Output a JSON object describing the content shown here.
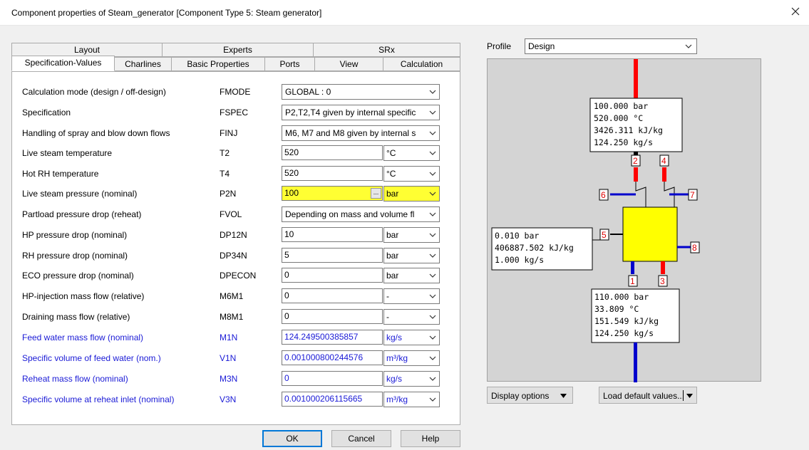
{
  "window": {
    "title": "Component properties of Steam_generator   [Component Type 5: Steam generator]"
  },
  "tabs_back": [
    "Layout",
    "Experts",
    "SRx"
  ],
  "tabs_front": [
    "Specification-Values",
    "Charlines",
    "Basic Properties",
    "Ports",
    "View",
    "Calculation"
  ],
  "rows": [
    {
      "label": "Calculation mode (design / off-design)",
      "code": "FMODE",
      "value": "GLOBAL : 0"
    },
    {
      "label": "Specification",
      "code": "FSPEC",
      "value": "P2,T2,T4 given by internal specific"
    },
    {
      "label": "Handling of spray and blow down flows",
      "code": "FINJ",
      "value": "M6, M7 and M8 given by internal s"
    },
    {
      "label": "Live steam temperature",
      "code": "T2",
      "value": "520",
      "unit": "°C"
    },
    {
      "label": "Hot RH temperature",
      "code": "T4",
      "value": "520",
      "unit": "°C"
    },
    {
      "label": "Live steam pressure (nominal)",
      "code": "P2N",
      "value": "100",
      "unit": "bar"
    },
    {
      "label": "Partload pressure drop (reheat)",
      "code": "FVOL",
      "value": "Depending on mass and volume fl"
    },
    {
      "label": "HP pressure drop (nominal)",
      "code": "DP12N",
      "value": "10",
      "unit": "bar"
    },
    {
      "label": "RH pressure drop (nominal)",
      "code": "DP34N",
      "value": "5",
      "unit": "bar"
    },
    {
      "label": "ECO pressure drop (nominal)",
      "code": "DPECON",
      "value": "0",
      "unit": "bar"
    },
    {
      "label": "HP-injection mass flow (relative)",
      "code": "M6M1",
      "value": "0",
      "unit": "-"
    },
    {
      "label": "Draining mass flow (relative)",
      "code": "M8M1",
      "value": "0",
      "unit": "-"
    },
    {
      "label": "Feed water mass flow (nominal)",
      "code": "M1N",
      "value": "124.249500385857",
      "unit": "kg/s"
    },
    {
      "label": "Specific volume of feed water (nom.)",
      "code": "V1N",
      "value": "0.001000800244576",
      "unit": "m³/kg"
    },
    {
      "label": "Reheat mass flow (nominal)",
      "code": "M3N",
      "value": "0",
      "unit": "kg/s"
    },
    {
      "label": "Specific volume at reheat inlet (nominal)",
      "code": "V3N",
      "value": "0.001000206115665",
      "unit": "m³/kg"
    }
  ],
  "buttons": {
    "ok": "OK",
    "cancel": "Cancel",
    "help": "Help"
  },
  "profile": {
    "label": "Profile",
    "value": "Design"
  },
  "diagram": {
    "top_box": [
      "100.000 bar",
      "520.000 °C",
      "3426.311 kJ/kg",
      "124.250 kg/s"
    ],
    "left_box": [
      "0.010 bar",
      "406887.502 kJ/kg",
      "1.000 kg/s"
    ],
    "bottom_box": [
      "110.000 bar",
      "33.809 °C",
      "151.549 kJ/kg",
      "124.250 kg/s"
    ],
    "ports": [
      "1",
      "2",
      "3",
      "4",
      "5",
      "6",
      "7",
      "8"
    ]
  },
  "display_options": "Display options",
  "load_defaults": "Load default values...",
  "colors": {
    "highlight": "#ffff33",
    "blue_text": "#1a1ad6",
    "steam": "#ff0000",
    "water": "#0000cc",
    "component": "#ffff00"
  }
}
